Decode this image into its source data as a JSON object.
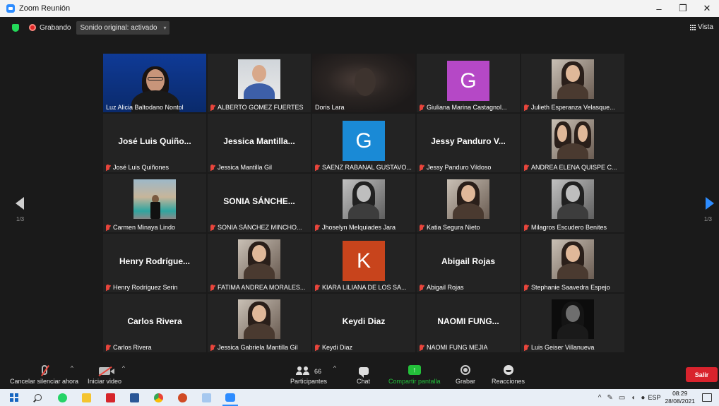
{
  "window": {
    "title": "Zoom Reunión",
    "minimize": "–",
    "restore": "❐",
    "close": "✕"
  },
  "topbar": {
    "recording": "Grabando",
    "sound": "Sonido original: activado",
    "sound_caret": "▾",
    "view": "Vista"
  },
  "pager": {
    "left": "1/3",
    "right": "1/3"
  },
  "tiles": [
    {
      "label": "Luz Alicia Baltodano Nontol",
      "muted": false,
      "kind": "video"
    },
    {
      "label": "ALBERTO GOMEZ FUERTES",
      "muted": true,
      "kind": "photo-office"
    },
    {
      "label": "Doris Lara",
      "muted": false,
      "kind": "blurred"
    },
    {
      "label": "Giuliana Marina Castagnol...",
      "muted": true,
      "kind": "letter",
      "letter": "G",
      "color": "#b548c6"
    },
    {
      "label": "Julieth Esperanza Velasque...",
      "muted": true,
      "kind": "photo"
    },
    {
      "big": "José Luis Quiño...",
      "label": "José Luis Quiñones",
      "muted": true,
      "kind": "name"
    },
    {
      "big": "Jessica  Mantilla...",
      "label": "Jessica Mantilla Gil",
      "muted": true,
      "kind": "name"
    },
    {
      "label": "SAENZ RABANAL GUSTAVO...",
      "muted": true,
      "kind": "letter",
      "letter": "G",
      "color": "#1a8ad6"
    },
    {
      "big": "Jessy Panduro V...",
      "label": "Jessy Panduro Vildoso",
      "muted": true,
      "kind": "name"
    },
    {
      "label": "ANDREA ELENA QUISPE C...",
      "muted": true,
      "kind": "photo-duo"
    },
    {
      "label": "Carmen Minaya Lindo",
      "muted": true,
      "kind": "photo-outdoor"
    },
    {
      "big": "SONIA  SÁNCHE...",
      "label": "SONIA SÁNCHEZ MINCHO...",
      "muted": true,
      "kind": "name"
    },
    {
      "label": "Jhoselyn Melquiades Jara",
      "muted": true,
      "kind": "photo-bw"
    },
    {
      "label": "Katia Segura Nieto",
      "muted": true,
      "kind": "photo"
    },
    {
      "label": "Milagros Escudero Benites",
      "muted": true,
      "kind": "photo-bw"
    },
    {
      "big": "Henry  Rodrígue...",
      "label": "Henry Rodríguez Serin",
      "muted": true,
      "kind": "name"
    },
    {
      "label": "FATIMA ANDREA MORALES...",
      "muted": true,
      "kind": "photo"
    },
    {
      "label": "KIARA LILIANA DE LOS SA...",
      "muted": true,
      "kind": "letter",
      "letter": "K",
      "color": "#c8441c"
    },
    {
      "big": "Abigail Rojas",
      "label": "Abigail Rojas",
      "muted": true,
      "kind": "name"
    },
    {
      "label": "Stephanie Saavedra Espejo",
      "muted": true,
      "kind": "photo"
    },
    {
      "big": "Carlos Rivera",
      "label": "Carlos Rivera",
      "muted": true,
      "kind": "name"
    },
    {
      "label": "Jessica Gabriela Mantilla Gil",
      "muted": true,
      "kind": "photo"
    },
    {
      "big": "Keydi Diaz",
      "label": "Keydi Diaz",
      "muted": true,
      "kind": "name"
    },
    {
      "big": "NAOMI FUNG...",
      "label": "NAOMI FUNG MEJIA",
      "muted": true,
      "kind": "name"
    },
    {
      "label": "Luis Geiser Villanueva",
      "muted": true,
      "kind": "photo-dark"
    }
  ],
  "toolbar": {
    "unmute": "Cancelar silenciar ahora",
    "video": "Iniciar video",
    "participants": "Participantes",
    "participant_count": "66",
    "chat": "Chat",
    "share": "Compartir pantalla",
    "record": "Grabar",
    "reactions": "Reacciones",
    "leave": "Salir",
    "caret": "^"
  },
  "taskbar": {
    "lang": "ESP",
    "time": "08:29",
    "date": "28/08/2021",
    "tray_up": "^"
  },
  "colors": {
    "share_green": "#23c03a",
    "leave_red": "#d9232d",
    "arrow_blue": "#2d8cff"
  }
}
